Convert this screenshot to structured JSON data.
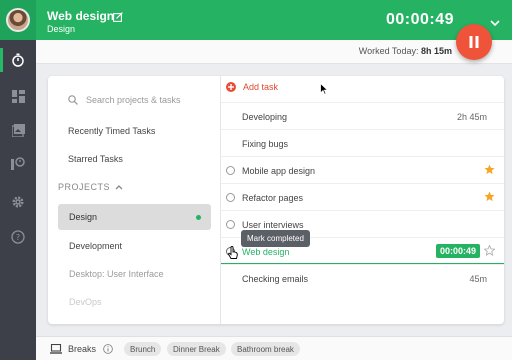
{
  "header": {
    "task_name": "Web design",
    "project_name": "Design",
    "timer": "00:00:49",
    "worked_today_label": "Worked Today:",
    "worked_today_value": "8h 15m"
  },
  "rail": {
    "icons": [
      "stopwatch-icon",
      "dashboard-icon",
      "gallery-icon",
      "integrations-icon",
      "settings-icon",
      "help-icon"
    ]
  },
  "sidebar": {
    "search_placeholder": "Search projects & tasks",
    "recent": "Recently Timed Tasks",
    "starred": "Starred Tasks",
    "projects_heading": "PROJECTS",
    "projects": [
      {
        "label": "Design"
      },
      {
        "label": "Development"
      },
      {
        "label": "Desktop: User Interface"
      },
      {
        "label": "DevOps"
      }
    ]
  },
  "tasks": {
    "add_label": "Add task",
    "rows": [
      {
        "name": "Developing",
        "duration": "2h 45m"
      },
      {
        "name": "Fixing bugs",
        "duration": ""
      },
      {
        "name": "Mobile app design",
        "duration": ""
      },
      {
        "name": "Refactor pages",
        "duration": ""
      },
      {
        "name": "User interviews",
        "duration": ""
      },
      {
        "name": "Web design",
        "duration": "00:00:49"
      },
      {
        "name": "Checking emails",
        "duration": "45m"
      }
    ],
    "tooltip": "Mark completed"
  },
  "breaks": {
    "label": "Breaks",
    "chips": [
      "Brunch",
      "Dinner Break",
      "Bathroom break"
    ]
  },
  "colors": {
    "brand_green": "#25b363",
    "pause_red": "#ef5339",
    "star_orange": "#f5a623"
  }
}
